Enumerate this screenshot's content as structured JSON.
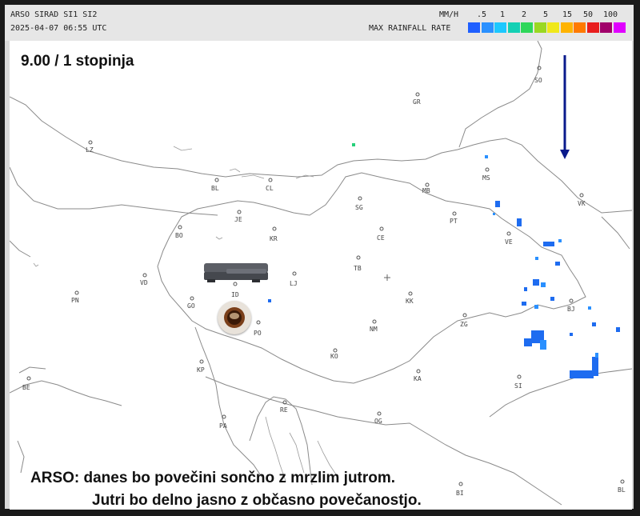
{
  "header": {
    "line1": "ARSO SIRAD SI1 SI2",
    "line2": "2025-04-07 06:55 UTC",
    "unit": "MM/H",
    "legend_title": "MAX RAINFALL RATE",
    "ticks": [
      ".5",
      "1",
      "2",
      "5",
      "15",
      "50",
      "100"
    ],
    "legend_colors": [
      "#1f5fff",
      "#2a90ff",
      "#1cc8ff",
      "#14d0b4",
      "#2fd75a",
      "#9ad822",
      "#f0e81a",
      "#ffb300",
      "#ff7a00",
      "#e81e1e",
      "#a0006a",
      "#e000ff"
    ]
  },
  "overlay": {
    "time_temp": "9.00   /   1 stopinja",
    "forecast_line1": "ARSO: danes bo povečini sončno z mrzlim jutrom.",
    "forecast_line2": "Jutri bo delno jasno z občasno povečanostjo."
  },
  "stations": [
    "SO",
    "GR",
    "LZ",
    "MS",
    "BL",
    "CL",
    "MB",
    "VK",
    "JE",
    "SG",
    "PT",
    "BO",
    "KR",
    "CE",
    "VE",
    "TB",
    "LJ",
    "VD",
    "PN",
    "ID",
    "KK",
    "BJ",
    "GO",
    "PO",
    "NM",
    "ZG",
    "KP",
    "KO",
    "KA",
    "SI",
    "PA",
    "RE",
    "OG",
    "BI",
    "BE",
    "BL"
  ],
  "colors": {
    "border_line": "#8a8a8a",
    "rain_main": "#1e6cf0",
    "rain_light": "#2a90ff",
    "rain_green": "#26d07a",
    "arrow": "#0a1a8c"
  },
  "icons": [
    "sofa-icon",
    "coffee-icon",
    "down-arrow-icon"
  ]
}
